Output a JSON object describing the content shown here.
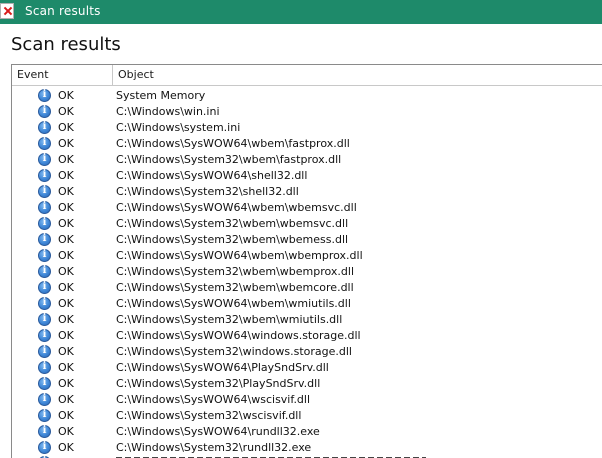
{
  "window": {
    "title": "Scan results",
    "icon": "app-x-icon",
    "accent_color": "#1e8a6a"
  },
  "page": {
    "title": "Scan results"
  },
  "table": {
    "columns": [
      "Event",
      "Object"
    ],
    "rows": [
      {
        "event": "OK",
        "object": "System Memory"
      },
      {
        "event": "OK",
        "object": "C:\\Windows\\win.ini"
      },
      {
        "event": "OK",
        "object": "C:\\Windows\\system.ini"
      },
      {
        "event": "OK",
        "object": "C:\\Windows\\SysWOW64\\wbem\\fastprox.dll"
      },
      {
        "event": "OK",
        "object": "C:\\Windows\\System32\\wbem\\fastprox.dll"
      },
      {
        "event": "OK",
        "object": "C:\\Windows\\SysWOW64\\shell32.dll"
      },
      {
        "event": "OK",
        "object": "C:\\Windows\\System32\\shell32.dll"
      },
      {
        "event": "OK",
        "object": "C:\\Windows\\SysWOW64\\wbem\\wbemsvc.dll"
      },
      {
        "event": "OK",
        "object": "C:\\Windows\\System32\\wbem\\wbemsvc.dll"
      },
      {
        "event": "OK",
        "object": "C:\\Windows\\System32\\wbem\\wbemess.dll"
      },
      {
        "event": "OK",
        "object": "C:\\Windows\\SysWOW64\\wbem\\wbemprox.dll"
      },
      {
        "event": "OK",
        "object": "C:\\Windows\\System32\\wbem\\wbemprox.dll"
      },
      {
        "event": "OK",
        "object": "C:\\Windows\\System32\\wbem\\wbemcore.dll"
      },
      {
        "event": "OK",
        "object": "C:\\Windows\\SysWOW64\\wbem\\wmiutils.dll"
      },
      {
        "event": "OK",
        "object": "C:\\Windows\\System32\\wbem\\wmiutils.dll"
      },
      {
        "event": "OK",
        "object": "C:\\Windows\\SysWOW64\\windows.storage.dll"
      },
      {
        "event": "OK",
        "object": "C:\\Windows\\System32\\windows.storage.dll"
      },
      {
        "event": "OK",
        "object": "C:\\Windows\\SysWOW64\\PlaySndSrv.dll"
      },
      {
        "event": "OK",
        "object": "C:\\Windows\\System32\\PlaySndSrv.dll"
      },
      {
        "event": "OK",
        "object": "C:\\Windows\\SysWOW64\\wscisvif.dll"
      },
      {
        "event": "OK",
        "object": "C:\\Windows\\System32\\wscisvif.dll"
      },
      {
        "event": "OK",
        "object": "C:\\Windows\\SysWOW64\\rundll32.exe"
      },
      {
        "event": "OK",
        "object": "C:\\Windows\\System32\\rundll32.exe"
      }
    ],
    "row_icon": "info-icon"
  }
}
